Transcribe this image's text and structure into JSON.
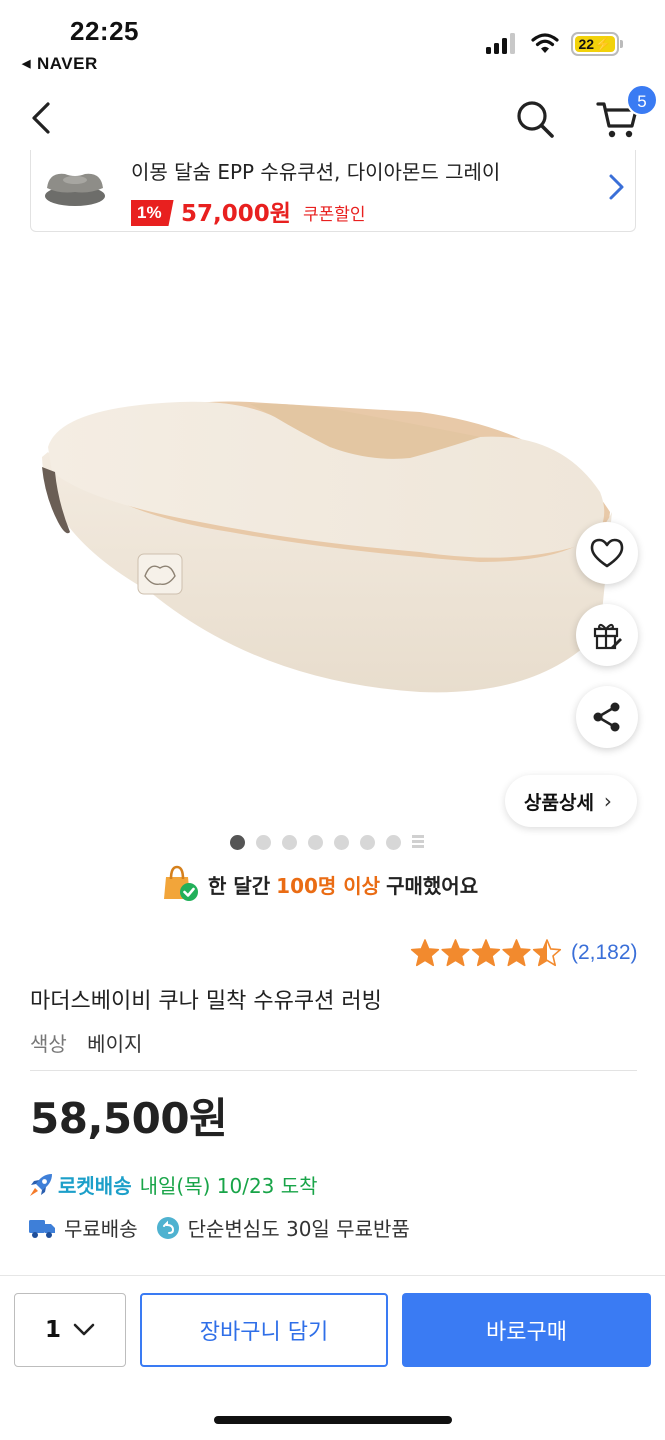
{
  "status_bar": {
    "time": "22:25",
    "back_app": "NAVER",
    "battery": "22"
  },
  "nav": {
    "cart_count": "5"
  },
  "banner": {
    "title": "이몽 달숨 EPP 수유쿠션, 다이아몬드 그레이",
    "discount": "1%",
    "price": "57,000원",
    "coupon": "쿠폰할인"
  },
  "gallery": {
    "detail_label": "상품상세",
    "dot_count": 7,
    "active_dot": 1
  },
  "notice": {
    "prefix": "한 달간",
    "highlight": "100명 이상",
    "suffix": "구매했어요"
  },
  "rating": {
    "value": 4.5,
    "count": "(2,182)"
  },
  "product": {
    "name": "마더스베이비 쿠나 밀착 수유쿠션 러빙",
    "option_label": "색상",
    "option_value": "베이지",
    "price": "58,500원"
  },
  "delivery": {
    "rocket_label": "로켓배송",
    "arrival": "내일(목) 10/23 도착",
    "free_shipping": "무료배송",
    "return_policy": "단순변심도 30일 무료반품"
  },
  "bottom_bar": {
    "quantity": "1",
    "cart_button": "장바구니 담기",
    "buy_button": "바로구매"
  },
  "colors": {
    "accent_blue": "#3a7bf3",
    "sale_red": "#e8201f",
    "highlight_orange": "#ea6c14",
    "star_orange": "#f28a2e",
    "rocket_teal": "#1c9fc9",
    "arrival_green": "#18a448"
  }
}
